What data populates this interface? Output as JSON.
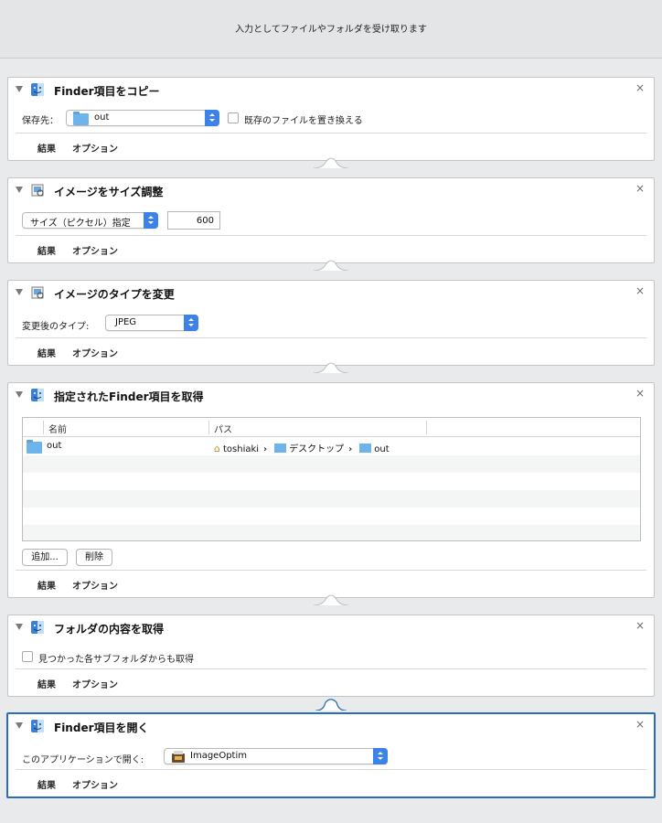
{
  "header": {
    "text": "入力としてファイルやフォルダを受け取ります"
  },
  "footer_labels": {
    "results": "結果",
    "options": "オプション"
  },
  "actions": {
    "copy": {
      "title": "Finder項目をコピー",
      "dest_label": "保存先：",
      "dest_value": "out",
      "replace_label": "既存のファイルを置き換える"
    },
    "resize": {
      "title": "イメージをサイズ調整",
      "mode_value": "サイズ（ピクセル）指定",
      "size_value": "600"
    },
    "convert": {
      "title": "イメージのタイプを変更",
      "type_label": "変更後のタイプ:",
      "type_value": "JPEG"
    },
    "get_items": {
      "title": "指定されたFinder項目を取得",
      "columns": [
        "名前",
        "パス"
      ],
      "rows": [
        {
          "name": "out",
          "path": [
            "toshiaki",
            "デスクトップ",
            "out"
          ]
        }
      ],
      "path_sep": "›",
      "add_label": "追加...",
      "remove_label": "削除"
    },
    "folder_contents": {
      "title": "フォルダの内容を取得",
      "recurse_label": "見つかった各サブフォルダからも取得"
    },
    "open_items": {
      "title": "Finder項目を開く",
      "app_label": "このアプリケーションで開く:",
      "app_value": "ImageOptim"
    }
  },
  "icons": {
    "finder": "finder-icon",
    "preview": "preview-icon",
    "folder": "folder-icon",
    "home": "home-icon",
    "app": "imageoptim-icon"
  },
  "colors": {
    "accent": "#3d82e6",
    "selected_border": "#2b6cb6",
    "folder": "#6cb4ea"
  }
}
